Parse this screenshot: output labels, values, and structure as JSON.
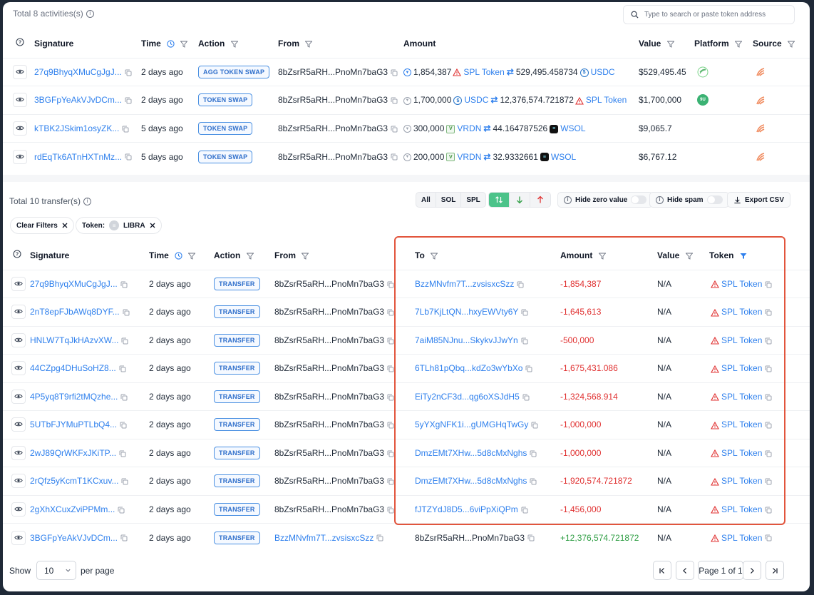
{
  "activities": {
    "total_label": "Total 8 activities(s)",
    "search_placeholder": "Type to search or paste token address",
    "columns": {
      "signature": "Signature",
      "time": "Time",
      "action": "Action",
      "from": "From",
      "amount": "Amount",
      "value": "Value",
      "platform": "Platform",
      "source": "Source"
    },
    "rows": [
      {
        "signature": "27q9BhyqXMuCgJgJ...",
        "time": "2 days ago",
        "action": "AGG TOKEN SWAP",
        "from": "8bZsrR5aRH...PnoMn7baG3",
        "amount_in": "1,854,387",
        "token_in": "SPL Token",
        "amount_out": "529,495.458734",
        "token_out": "USDC",
        "value": "$529,495.45"
      },
      {
        "signature": "3BGFpYeAkVJvDCm...",
        "time": "2 days ago",
        "action": "TOKEN SWAP",
        "from": "8bZsrR5aRH...PnoMn7baG3",
        "amount_in": "1,700,000",
        "token_in": "USDC",
        "amount_out": "12,376,574.721872",
        "token_out": "SPL Token",
        "value": "$1,700,000"
      },
      {
        "signature": "kTBK2JSkim1osyZK...",
        "time": "5 days ago",
        "action": "TOKEN SWAP",
        "from": "8bZsrR5aRH...PnoMn7baG3",
        "amount_in": "300,000",
        "token_in": "VRDN",
        "amount_out": "44.164787526",
        "token_out": "WSOL",
        "value": "$9,065.7"
      },
      {
        "signature": "rdEqTk6ATnHXTnMz...",
        "time": "5 days ago",
        "action": "TOKEN SWAP",
        "from": "8bZsrR5aRH...PnoMn7baG3",
        "amount_in": "200,000",
        "token_in": "VRDN",
        "amount_out": "32.9332661",
        "token_out": "WSOL",
        "value": "$6,767.12"
      }
    ]
  },
  "transfers": {
    "total_label": "Total 10 transfer(s)",
    "segment": [
      "All",
      "SOL",
      "SPL"
    ],
    "hide_zero_value": "Hide zero value",
    "hide_spam": "Hide spam",
    "export_csv": "Export CSV",
    "clear_filters": "Clear Filters",
    "token_chip_label": "Token:",
    "token_chip_value": "LIBRA",
    "columns": {
      "signature": "Signature",
      "time": "Time",
      "action": "Action",
      "from": "From",
      "to": "To",
      "amount": "Amount",
      "value": "Value",
      "token": "Token"
    },
    "rows": [
      {
        "signature": "27q9BhyqXMuCgJgJ...",
        "time": "2 days ago",
        "action": "TRANSFER",
        "from": "8bZsrR5aRH...PnoMn7baG3",
        "to": "BzzMNvfm7T...zvsisxcSzz",
        "amount": "-1,854,387",
        "value": "N/A",
        "token": "SPL Token"
      },
      {
        "signature": "2nT8epFJbAWq8DYF...",
        "time": "2 days ago",
        "action": "TRANSFER",
        "from": "8bZsrR5aRH...PnoMn7baG3",
        "to": "7Lb7KjLtQN...hxyEWVty6Y",
        "amount": "-1,645,613",
        "value": "N/A",
        "token": "SPL Token"
      },
      {
        "signature": "HNLW7TqJkHAzvXW...",
        "time": "2 days ago",
        "action": "TRANSFER",
        "from": "8bZsrR5aRH...PnoMn7baG3",
        "to": "7aiM85NJnu...SkykvJJwYn",
        "amount": "-500,000",
        "value": "N/A",
        "token": "SPL Token"
      },
      {
        "signature": "44CZpg4DHuSoHZ8...",
        "time": "2 days ago",
        "action": "TRANSFER",
        "from": "8bZsrR5aRH...PnoMn7baG3",
        "to": "6TLh81pQbq...kdZo3wYbXo",
        "amount": "-1,675,431.086",
        "value": "N/A",
        "token": "SPL Token"
      },
      {
        "signature": "4P5yq8T9rfi2tMQzhe...",
        "time": "2 days ago",
        "action": "TRANSFER",
        "from": "8bZsrR5aRH...PnoMn7baG3",
        "to": "EiTy2nCF3d...qg6oXSJdH5",
        "amount": "-1,324,568.914",
        "value": "N/A",
        "token": "SPL Token"
      },
      {
        "signature": "5UTbFJYMuPTLbQ4...",
        "time": "2 days ago",
        "action": "TRANSFER",
        "from": "8bZsrR5aRH...PnoMn7baG3",
        "to": "5yYXgNFK1i...gUMGHqTwGy",
        "amount": "-1,000,000",
        "value": "N/A",
        "token": "SPL Token"
      },
      {
        "signature": "2wJ89QrWKFxJKiTP...",
        "time": "2 days ago",
        "action": "TRANSFER",
        "from": "8bZsrR5aRH...PnoMn7baG3",
        "to": "DmzEMt7XHw...5d8cMxNghs",
        "amount": "-1,000,000",
        "value": "N/A",
        "token": "SPL Token"
      },
      {
        "signature": "2rQfz5yKcmT1KCxuv...",
        "time": "2 days ago",
        "action": "TRANSFER",
        "from": "8bZsrR5aRH...PnoMn7baG3",
        "to": "DmzEMt7XHw...5d8cMxNghs",
        "amount": "-1,920,574.721872",
        "value": "N/A",
        "token": "SPL Token"
      },
      {
        "signature": "2gXhXCuxZviPPMm...",
        "time": "2 days ago",
        "action": "TRANSFER",
        "from": "8bZsrR5aRH...PnoMn7baG3",
        "to": "fJTZYdJ8D5...6viPpXiQPm",
        "amount": "-1,456,000",
        "value": "N/A",
        "token": "SPL Token"
      },
      {
        "signature": "3BGFpYeAkVJvDCm...",
        "time": "2 days ago",
        "action": "TRANSFER",
        "from": "BzzMNvfm7T...zvsisxcSzz",
        "to": "8bZsrR5aRH...PnoMn7baG3",
        "amount": "+12,376,574.721872",
        "value": "N/A",
        "token": "SPL Token"
      }
    ]
  },
  "footer": {
    "show_label": "Show",
    "per_page_value": "10",
    "per_page_label": "per page",
    "page_label": "Page 1 of 1"
  },
  "colors": {
    "accent": "#2f80ed",
    "negative": "#e03131",
    "positive": "#2f9e44",
    "highlight": "#e2553d",
    "active_segment": "#4cc38a"
  }
}
